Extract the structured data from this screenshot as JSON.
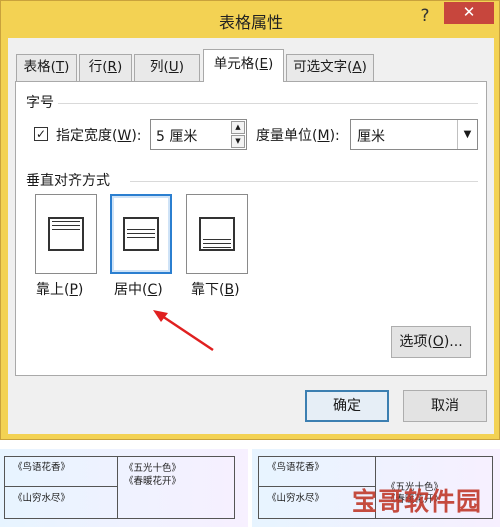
{
  "window": {
    "title": "表格属性",
    "help_label": "?",
    "close_label": "✕"
  },
  "tabs": [
    {
      "label": "表格",
      "key": "T"
    },
    {
      "label": "行",
      "key": "R"
    },
    {
      "label": "列",
      "key": "U"
    },
    {
      "label": "单元格",
      "key": "E",
      "active": true
    },
    {
      "label": "可选文字",
      "key": "A"
    }
  ],
  "size_section": {
    "heading": "字号",
    "checkbox_checked": true,
    "checkbox_mark": "✓",
    "specify_width_label": "指定宽度",
    "specify_width_key": "W",
    "width_value": "5 厘米",
    "unit_label": "度量单位",
    "unit_key": "M",
    "unit_value": "厘米"
  },
  "valign_section": {
    "heading": "垂直对齐方式",
    "options": [
      {
        "label": "靠上",
        "key": "P"
      },
      {
        "label": "居中",
        "key": "C",
        "selected": true
      },
      {
        "label": "靠下",
        "key": "B"
      }
    ]
  },
  "options_button": {
    "label": "选项",
    "key": "O",
    "suffix": "..."
  },
  "footer": {
    "ok_label": "确定",
    "cancel_label": "取消"
  },
  "annotation_color": "#e02020",
  "doc_preview": {
    "left": {
      "c1": "《鸟语花香》",
      "c2": "《山穷水尽》",
      "c3a": "《五光十色》",
      "c3b": "《春暖花开》"
    },
    "right": {
      "c1": "《鸟语花香》",
      "c2": "《山穷水尽》",
      "c3a": "《五光十色》",
      "c3b": "《春暖花开》"
    }
  },
  "watermark": "宝哥软件园"
}
